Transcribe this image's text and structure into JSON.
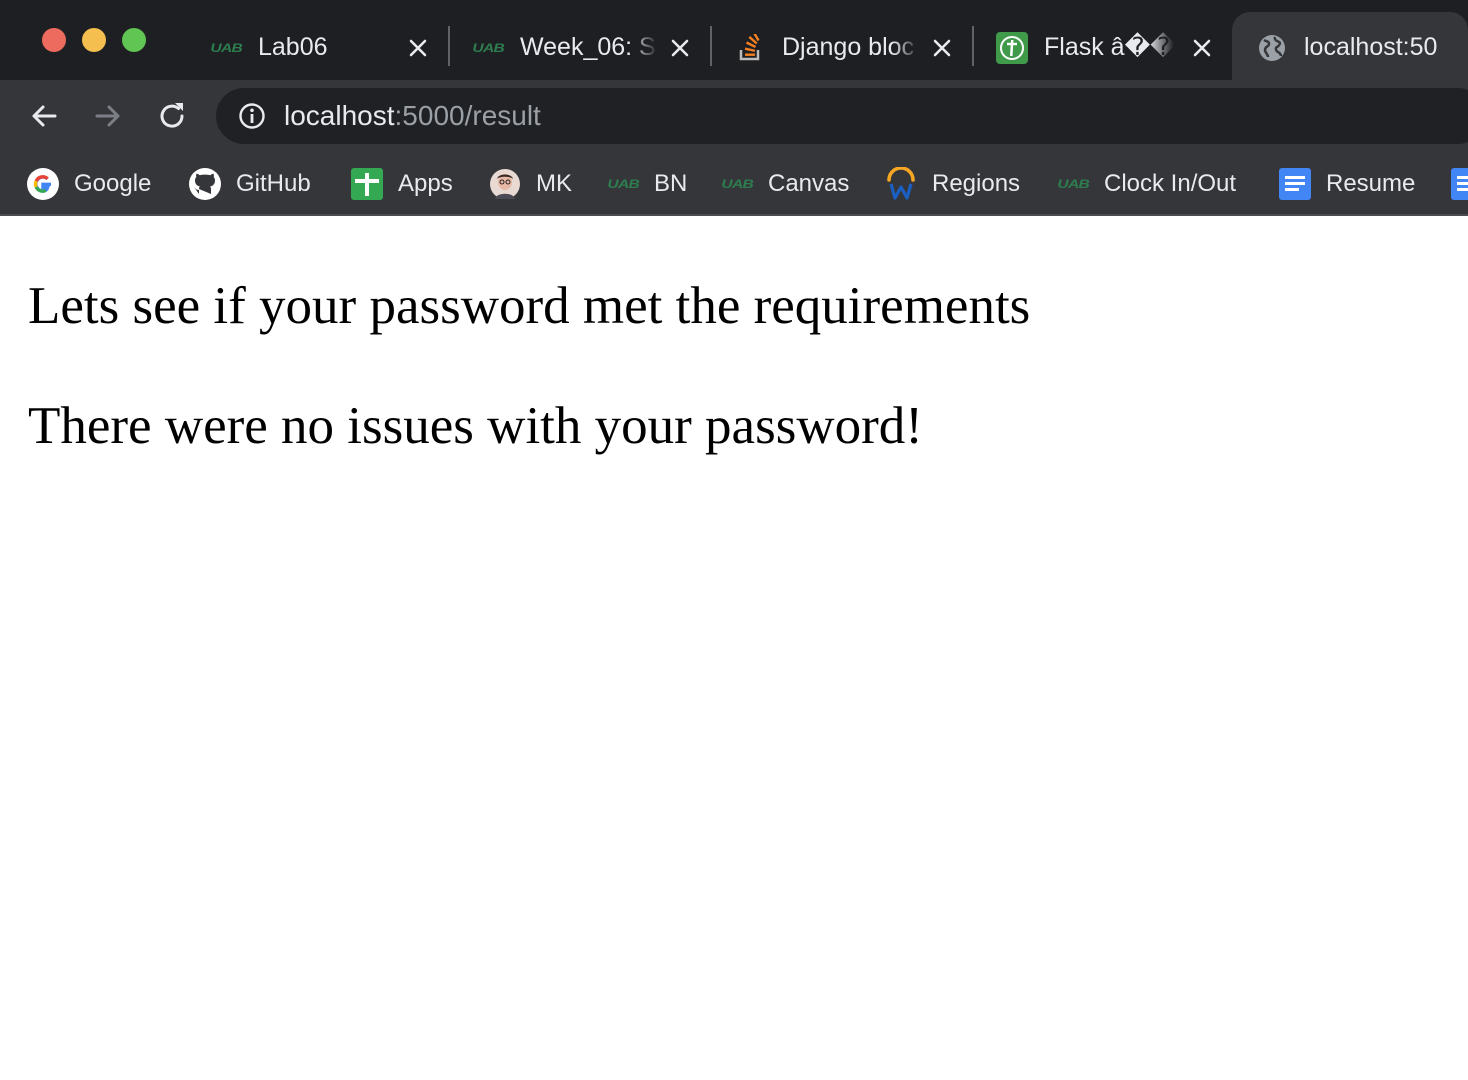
{
  "window": {
    "traffic_lights": [
      "close",
      "minimize",
      "zoom"
    ]
  },
  "tabs": [
    {
      "title": "Lab06",
      "favicon": "uab-logo",
      "active": false
    },
    {
      "title": "Week_06: S",
      "favicon": "uab-logo",
      "active": false
    },
    {
      "title": "Django bloc",
      "favicon": "stackoverflow-icon",
      "active": false
    },
    {
      "title": "Flask â��",
      "favicon": "flask-icon",
      "active": false
    },
    {
      "title": "localhost:50",
      "favicon": "globe-icon",
      "active": true
    }
  ],
  "uab_logo_text": "UAB",
  "toolbar": {
    "back": "back-arrow-icon",
    "forward": "forward-arrow-icon",
    "reload": "reload-icon",
    "url_host": "localhost",
    "url_rest": ":5000/result"
  },
  "bookmarks": [
    {
      "label": "Google",
      "icon": "google-icon"
    },
    {
      "label": "GitHub",
      "icon": "github-icon"
    },
    {
      "label": "Apps",
      "icon": "apps-icon"
    },
    {
      "label": "MK",
      "icon": "avatar-icon"
    },
    {
      "label": "BN",
      "icon": "uab-logo"
    },
    {
      "label": "Canvas",
      "icon": "uab-logo"
    },
    {
      "label": "Regions",
      "icon": "workday-icon"
    },
    {
      "label": "Clock In/Out",
      "icon": "uab-logo"
    },
    {
      "label": "Resume",
      "icon": "docs-icon"
    }
  ],
  "page": {
    "heading1": "Lets see if your password met the requirements",
    "heading2": "There were no issues with your password!"
  },
  "colors": {
    "tabstrip_bg": "#1e1f23",
    "toolbar_bg": "#35363a",
    "omnibox_bg": "#202124",
    "text_light": "#e8eaed",
    "text_dim": "#9aa0a6",
    "uab_green": "#2d7d4f"
  }
}
